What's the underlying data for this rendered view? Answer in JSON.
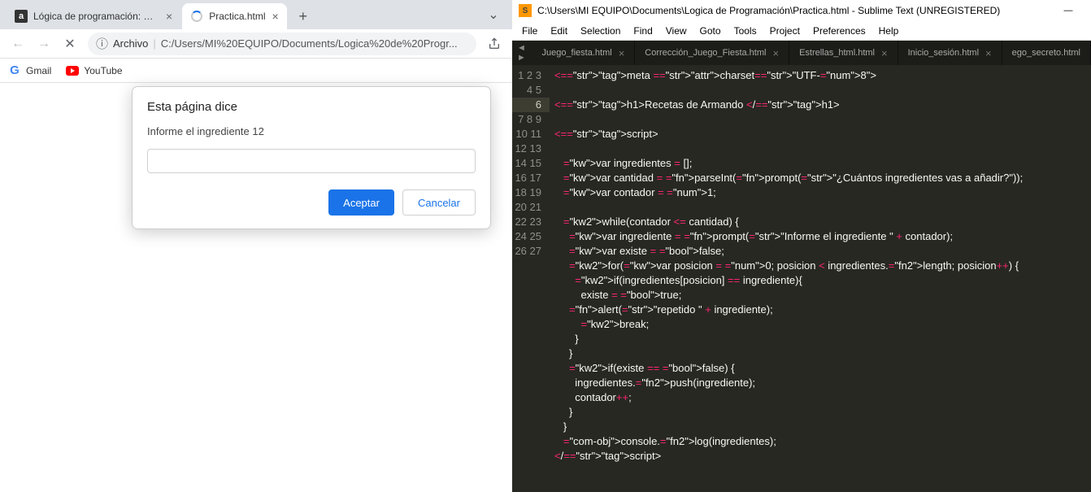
{
  "browser": {
    "tabs": [
      {
        "title": "Lógica de programación: Concep",
        "favicon": "alura"
      },
      {
        "title": "Practica.html",
        "favicon": "spinner"
      }
    ],
    "addressBar": {
      "scheme": "Archivo",
      "url": "C:/Users/MI%20EQUIPO/Documents/Logica%20de%20Progr..."
    },
    "bookmarks": [
      {
        "label": "Gmail",
        "icon": "G"
      },
      {
        "label": "YouTube",
        "icon": "yt"
      }
    ],
    "dialog": {
      "title": "Esta página dice",
      "message": "Informe el ingrediente 12",
      "value": "",
      "okLabel": "Aceptar",
      "cancelLabel": "Cancelar"
    }
  },
  "sublime": {
    "title": "C:\\Users\\MI EQUIPO\\Documents\\Logica de Programación\\Practica.html - Sublime Text (UNREGISTERED)",
    "menus": [
      "File",
      "Edit",
      "Selection",
      "Find",
      "View",
      "Goto",
      "Tools",
      "Project",
      "Preferences",
      "Help"
    ],
    "tabs": [
      "Juego_fiesta.html",
      "Corrección_Juego_Fiesta.html",
      "Estrellas_html.html",
      "Inicio_sesión.html",
      "ego_secreto.html"
    ],
    "gutter": {
      "lines": 27,
      "highlight": 6
    },
    "code": [
      "<meta charset=\"UTF-8\">",
      "",
      "<h1>Recetas de Armando </h1>",
      "",
      "<script>",
      "",
      "   var ingredientes = [];",
      "   var cantidad = parseInt(prompt(\"¿Cuántos ingredientes vas a añadir?\"));",
      "   var contador = 1;",
      "",
      "   while(contador <= cantidad) {",
      "     var ingrediente = prompt(\"Informe el ingrediente \" + contador);",
      "     var existe = false;",
      "     for(var posicion = 0; posicion < ingredientes.length; posicion++) {",
      "       if(ingredientes[posicion] == ingrediente){",
      "         existe = true;",
      "     alert(\"repetido \" + ingrediente);",
      "         break;",
      "       }",
      "     }",
      "     if(existe == false) {",
      "       ingredientes.push(ingrediente);",
      "       contador++;",
      "     }",
      "   }",
      "   console.log(ingredientes);",
      "</script>"
    ]
  }
}
